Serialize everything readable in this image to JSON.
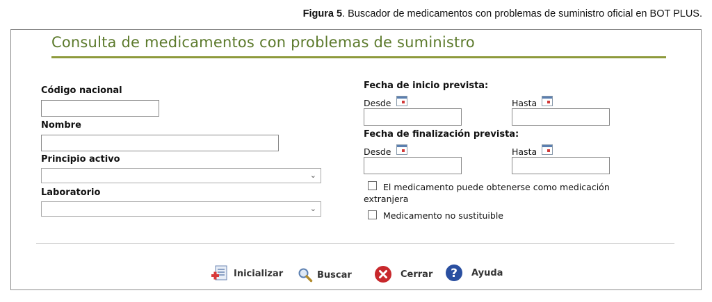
{
  "caption": {
    "figure_label": "Figura 5",
    "text": ". Buscador de medicamentos con problemas de suministro oficial en BOT PLUS."
  },
  "form": {
    "title": "Consulta de medicamentos con problemas de suministro",
    "codigo_nacional": {
      "label": "Código nacional",
      "value": ""
    },
    "nombre": {
      "label": "Nombre",
      "value": ""
    },
    "principio_activo": {
      "label": "Principio activo",
      "selected": ""
    },
    "laboratorio": {
      "label": "Laboratorio",
      "selected": ""
    },
    "fecha_inicio": {
      "label": "Fecha de inicio prevista:",
      "desde_label": "Desde",
      "hasta_label": "Hasta",
      "desde_value": "",
      "hasta_value": ""
    },
    "fecha_fin": {
      "label": "Fecha de finalización prevista:",
      "desde_label": "Desde",
      "hasta_label": "Hasta",
      "desde_value": "",
      "hasta_value": ""
    },
    "check_extranjera": {
      "label": "El medicamento puede obtenerse como medicación extranjera",
      "checked": false
    },
    "check_no_sustituible": {
      "label": "Medicamento no sustituible",
      "checked": false
    }
  },
  "buttons": {
    "inicializar": {
      "label": "Inicializar",
      "icon": "reset-form-icon"
    },
    "buscar": {
      "label": "Buscar",
      "icon": "magnifier-icon"
    },
    "cerrar": {
      "label": "Cerrar",
      "icon": "close-icon",
      "color": "#c8282c"
    },
    "ayuda": {
      "label": "Ayuda",
      "icon": "help-icon",
      "color": "#2a4fa0"
    }
  }
}
